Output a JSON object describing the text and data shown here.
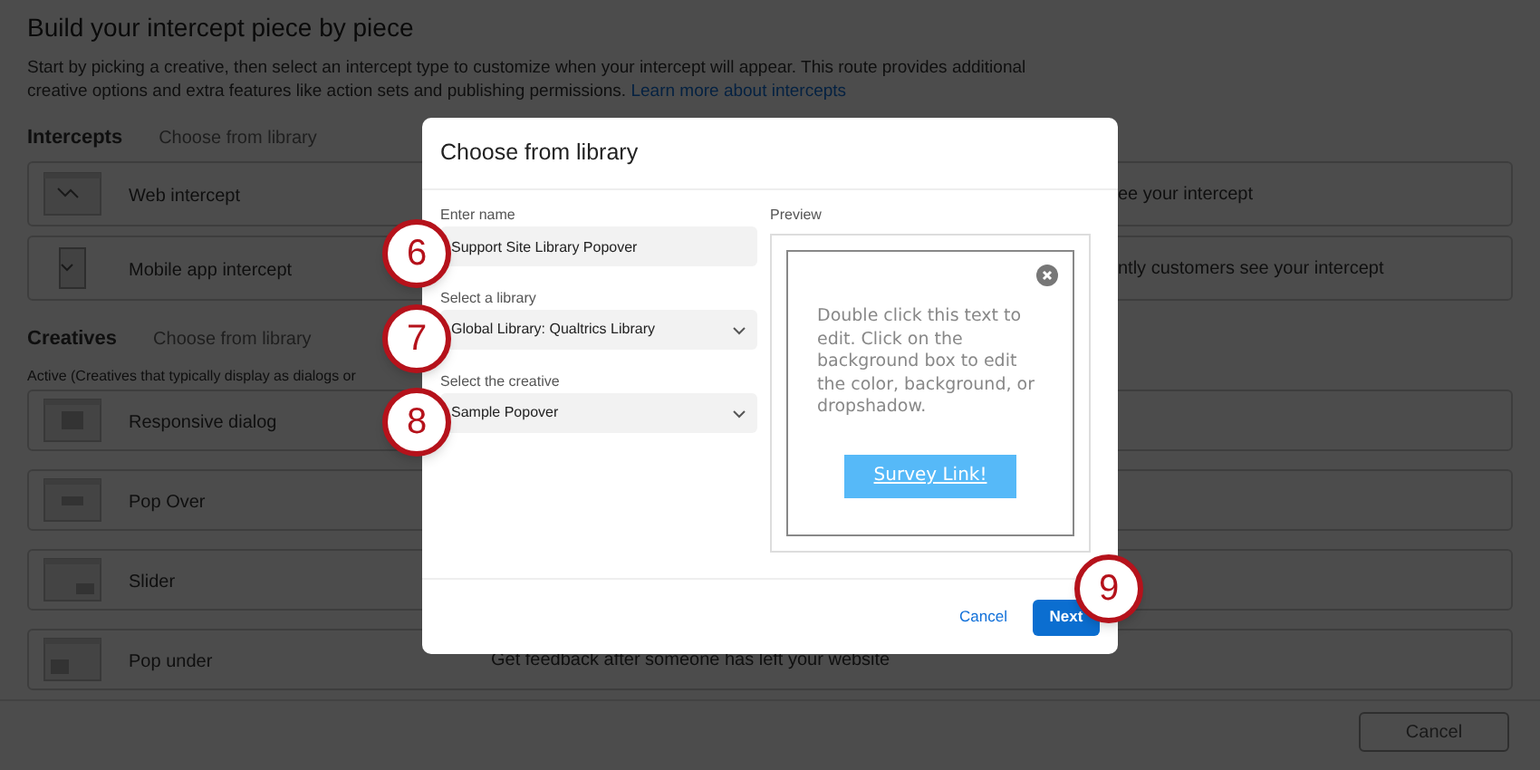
{
  "page": {
    "title": "Build your intercept piece by piece",
    "description": "Start by picking a creative, then select an intercept type to customize when your intercept will appear. This route provides additional creative options and extra features like action sets and publishing permissions.",
    "learn_link": "Learn more about intercepts",
    "intercepts": {
      "heading": "Intercepts",
      "library_link": "Choose from library",
      "items": [
        {
          "kind": "web",
          "label": "Web intercept",
          "description": "ee your intercept"
        },
        {
          "kind": "mobile",
          "label": "Mobile app intercept",
          "description": "ntly customers see your intercept"
        }
      ]
    },
    "creatives": {
      "heading": "Creatives",
      "library_link": "Choose from library",
      "group_label": "Active (Creatives that typically display as dialogs or",
      "items": [
        {
          "kind": "dialog",
          "label": "Responsive dialog"
        },
        {
          "kind": "popover",
          "label": "Pop Over"
        },
        {
          "kind": "slider",
          "label": "Slider"
        },
        {
          "kind": "popunder",
          "label": "Pop under",
          "description": "Get feedback after someone has left your website"
        }
      ]
    },
    "cancel_button": "Cancel"
  },
  "dialog": {
    "title": "Choose from library",
    "fields": [
      {
        "kind": "text",
        "label": "Enter name",
        "value": "Support Site Library Popover",
        "callout": "6"
      },
      {
        "kind": "select",
        "label": "Select a library",
        "value": "Global Library: Qualtrics Library",
        "callout": "7"
      },
      {
        "kind": "select",
        "label": "Select the creative",
        "value": "Sample Popover",
        "callout": "8"
      }
    ],
    "preview": {
      "label": "Preview",
      "text": "Double click this text to edit. Click on the background box to edit the color, background, or dropshadow.",
      "link": "Survey Link!"
    },
    "cancel": "Cancel",
    "next": "Next",
    "next_callout": "9"
  }
}
